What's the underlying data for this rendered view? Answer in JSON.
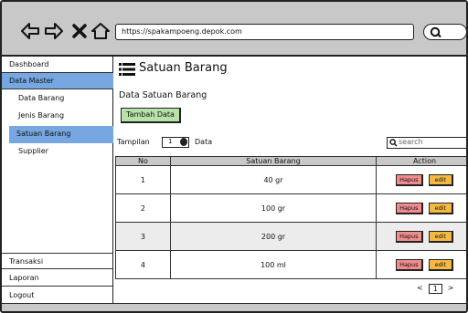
{
  "browser": {
    "url": "https://spakampoeng.depok.com",
    "icons": [
      "back-arrow-icon",
      "forward-arrow-icon",
      "close-icon",
      "home-icon",
      "search-icon"
    ]
  },
  "sidebar": {
    "items": [
      {
        "label": "Dashboard",
        "active": false
      },
      {
        "label": "Data Master",
        "active": true
      },
      {
        "label": "Transaksi",
        "active": false
      },
      {
        "label": "Laporan",
        "active": false
      },
      {
        "label": "Logout",
        "active": false
      }
    ],
    "sub_items": [
      {
        "label": "Data Barang",
        "active": false
      },
      {
        "label": "Jenis Barang",
        "active": false
      },
      {
        "label": "Satuan Barang",
        "active": true
      },
      {
        "label": "Supplier",
        "active": false
      }
    ],
    "active_color": "#76a7e0"
  },
  "main": {
    "page_title": "Satuan Barang",
    "section_title": "Data Satuan Barang",
    "add_button": "Tambah Data",
    "show_label": "Tampilan",
    "show_value": "1",
    "show_suffix": "Data",
    "search_placeholder": "search",
    "table": {
      "columns": [
        "No",
        "Satuan Barang",
        "Action"
      ],
      "rows": [
        {
          "no": "1",
          "satuan": "40 gr"
        },
        {
          "no": "2",
          "satuan": "100 gr"
        },
        {
          "no": "3",
          "satuan": "200 gr"
        },
        {
          "no": "4",
          "satuan": "100 ml"
        }
      ],
      "delete_label": "Hapus",
      "edit_label": "edit"
    },
    "pager": {
      "prev": "<",
      "page": "1",
      "next": ">"
    }
  },
  "colors": {
    "toolbar": "#c8c8c8",
    "add_button": "#b7e2a8",
    "delete_button": "#f08c8c",
    "edit_button": "#f4b942"
  }
}
